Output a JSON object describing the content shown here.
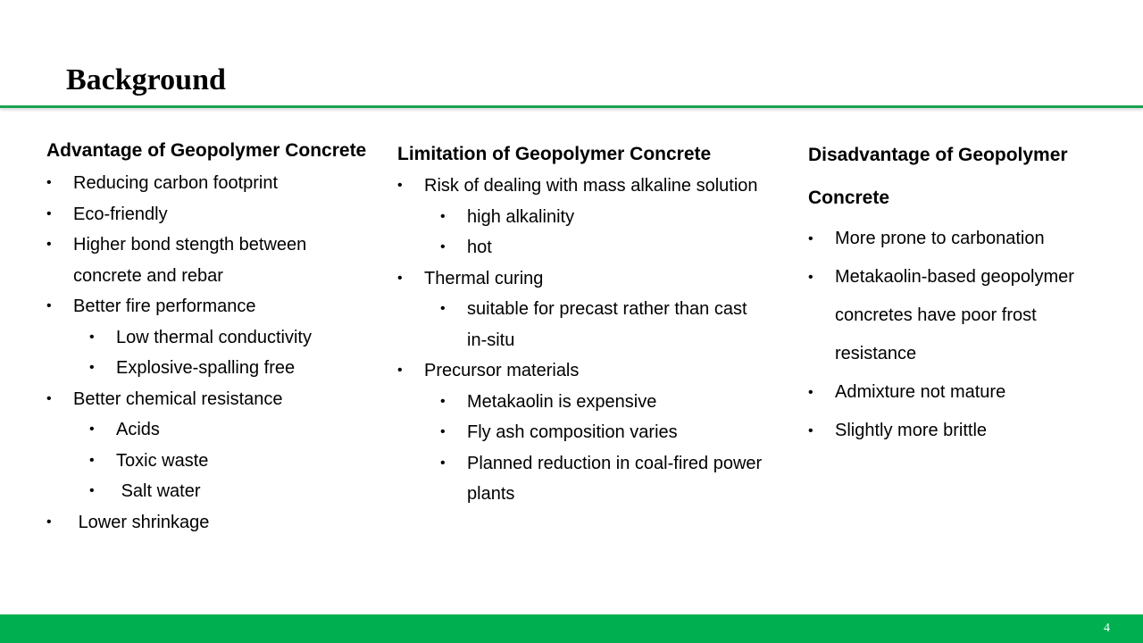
{
  "slide": {
    "title": "Background",
    "page_number": "4",
    "colors": {
      "accent_green": "#00b050",
      "rule_green": "#1aa352"
    }
  },
  "columns": [
    {
      "heading": "Advantage of Geopolymer Concrete",
      "items": [
        {
          "text": "Reducing carbon footprint",
          "level": 1
        },
        {
          "text": "Eco-friendly",
          "level": 1
        },
        {
          "text": "Higher bond stength between concrete and rebar",
          "level": 1
        },
        {
          "text": "Better fire performance",
          "level": 1
        },
        {
          "text": "Low thermal conductivity",
          "level": 2
        },
        {
          "text": "Explosive-spalling free",
          "level": 2
        },
        {
          "text": "Better chemical resistance",
          "level": 1
        },
        {
          "text": "Acids",
          "level": 2
        },
        {
          "text": "Toxic waste",
          "level": 2
        },
        {
          "text": " Salt water",
          "level": 2
        },
        {
          "text": " Lower shrinkage",
          "level": 1
        }
      ]
    },
    {
      "heading": "Limitation of Geopolymer Concrete",
      "items": [
        {
          "text": "Risk of dealing with mass alkaline solution",
          "level": 1
        },
        {
          "text": "high alkalinity",
          "level": 2
        },
        {
          "text": "hot",
          "level": 2
        },
        {
          "text": "Thermal curing",
          "level": 1
        },
        {
          "text": "suitable for precast rather than cast in-situ",
          "level": 2
        },
        {
          "text": "Precursor materials",
          "level": 1
        },
        {
          "text": "Metakaolin is expensive",
          "level": 2
        },
        {
          "text": "Fly ash composition varies",
          "level": 2
        },
        {
          "text": "Planned reduction in coal-fired power plants",
          "level": 2
        }
      ]
    },
    {
      "heading": "Disadvantage of Geopolymer Concrete",
      "items": [
        {
          "text": "More prone to carbonation",
          "level": 1
        },
        {
          "text": "Metakaolin-based geopolymer concretes have poor frost resistance",
          "level": 1
        },
        {
          "text": "Admixture not mature",
          "level": 1
        },
        {
          "text": "Slightly more brittle",
          "level": 1
        }
      ]
    }
  ],
  "bullet_glyph": "•"
}
